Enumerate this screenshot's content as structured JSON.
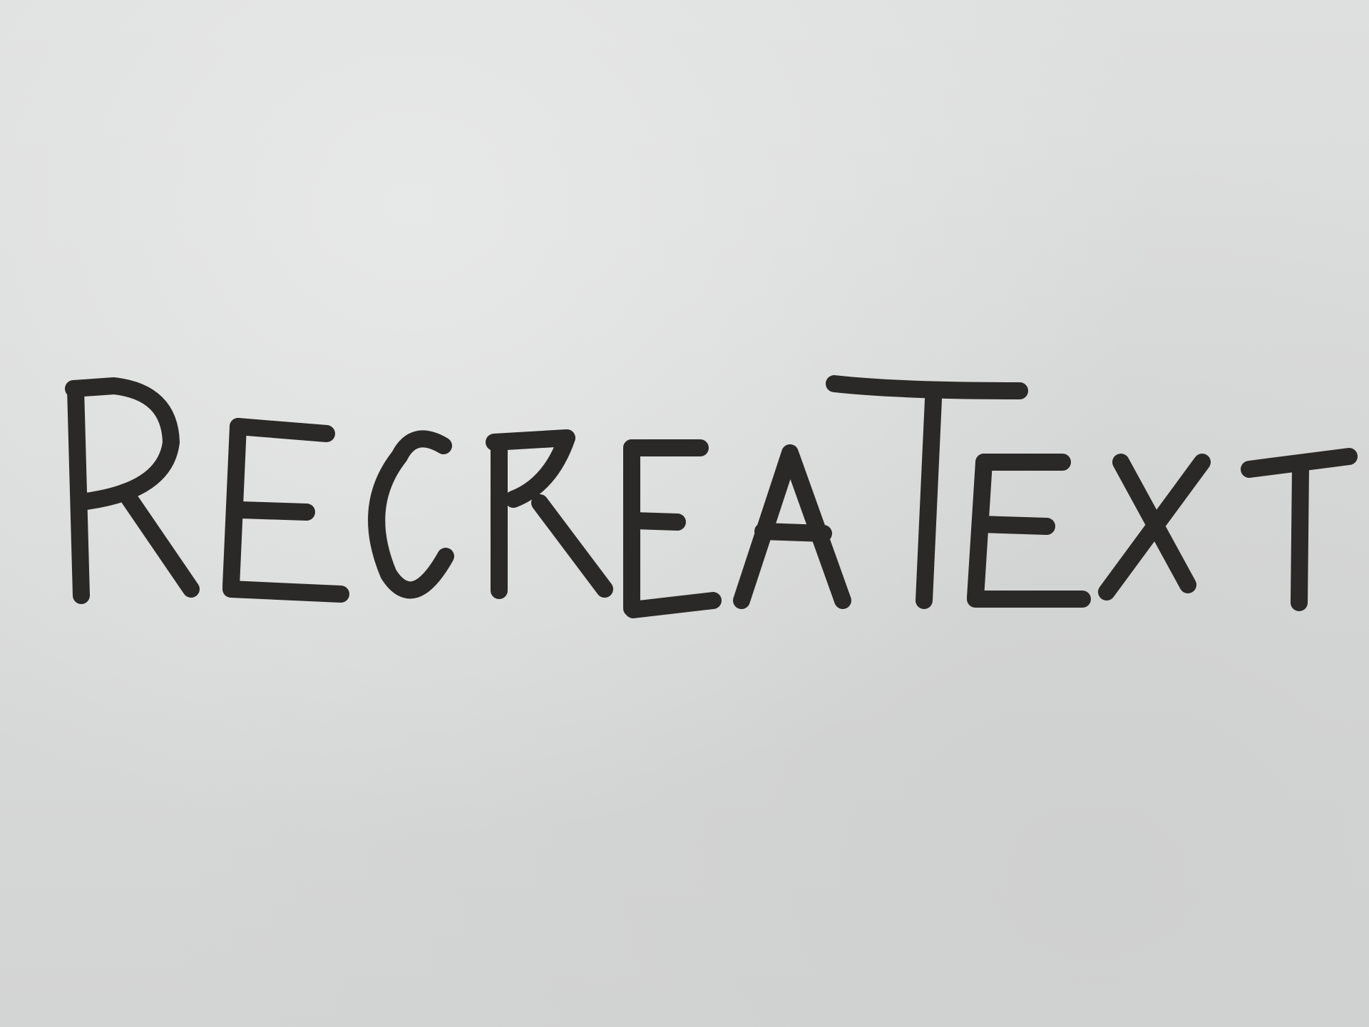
{
  "paper": {
    "background_color": "#d8d9d9",
    "ink_color": "#2b2927"
  },
  "handwriting": {
    "text": "RecreaText"
  }
}
